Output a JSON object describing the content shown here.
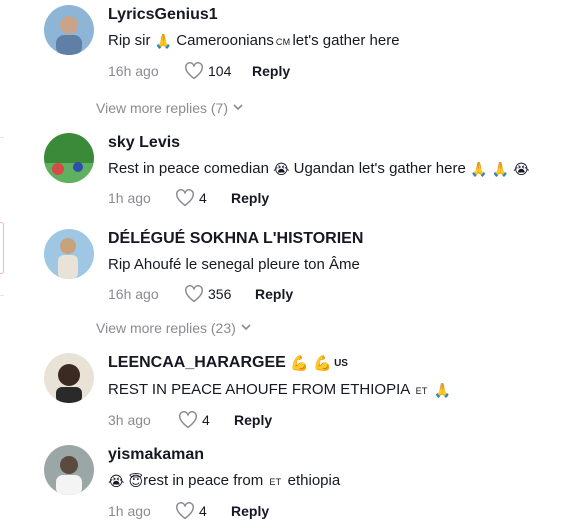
{
  "comments": [
    {
      "username": "LyricsGenius1",
      "text_parts": [
        "Rip sir ",
        "🙏",
        " Cameroonians",
        "CM",
        "let's gather here"
      ],
      "time": "16h ago",
      "likes": "104",
      "reply_label": "Reply",
      "avatar_colors": [
        "#8fb5d6",
        "#c9a48a"
      ]
    },
    {
      "username": "sky Levis",
      "text_parts": [
        "Rest in peace comedian ",
        "😭",
        "  Ugandan let's gather here ",
        "🙏",
        " ",
        "🙏",
        " ",
        "😭"
      ],
      "time": "1h ago",
      "likes": "4",
      "reply_label": "Reply",
      "avatar_colors": [
        "#3a8a3a",
        "#d64a4a"
      ]
    },
    {
      "username": "DÉLÉGUÉ SOKHNA L'HISTORIEN",
      "text_parts": [
        "Rip Ahoufé le senegal pleure ton Âme"
      ],
      "time": "16h ago",
      "likes": "356",
      "reply_label": "Reply",
      "avatar_colors": [
        "#9fc7e3",
        "#c7a27a"
      ]
    },
    {
      "username": "LEENCAA_HARARGEE",
      "username_suffix": [
        "💪",
        "💪",
        "US"
      ],
      "text_parts": [
        "REST IN PEACE AHOUFE FROM ETHIOPIA ",
        "ET",
        " ",
        "🙏"
      ],
      "time": "3h ago",
      "likes": "4",
      "reply_label": "Reply",
      "avatar_colors": [
        "#e9e2d6",
        "#3b2a22"
      ]
    },
    {
      "username": "yismakaman",
      "text_parts": [
        "😭",
        " ",
        "😇",
        "rest in peace from ",
        "ET",
        " ethiopia"
      ],
      "time": "1h ago",
      "likes": "4",
      "reply_label": "Reply",
      "avatar_colors": [
        "#9aa7a6",
        "#5b4a40"
      ]
    }
  ],
  "view_more": [
    "View more replies (7)",
    "View more replies (23)"
  ],
  "icons": {
    "heart": "heart-outline-icon",
    "chevron": "chevron-down-icon"
  }
}
